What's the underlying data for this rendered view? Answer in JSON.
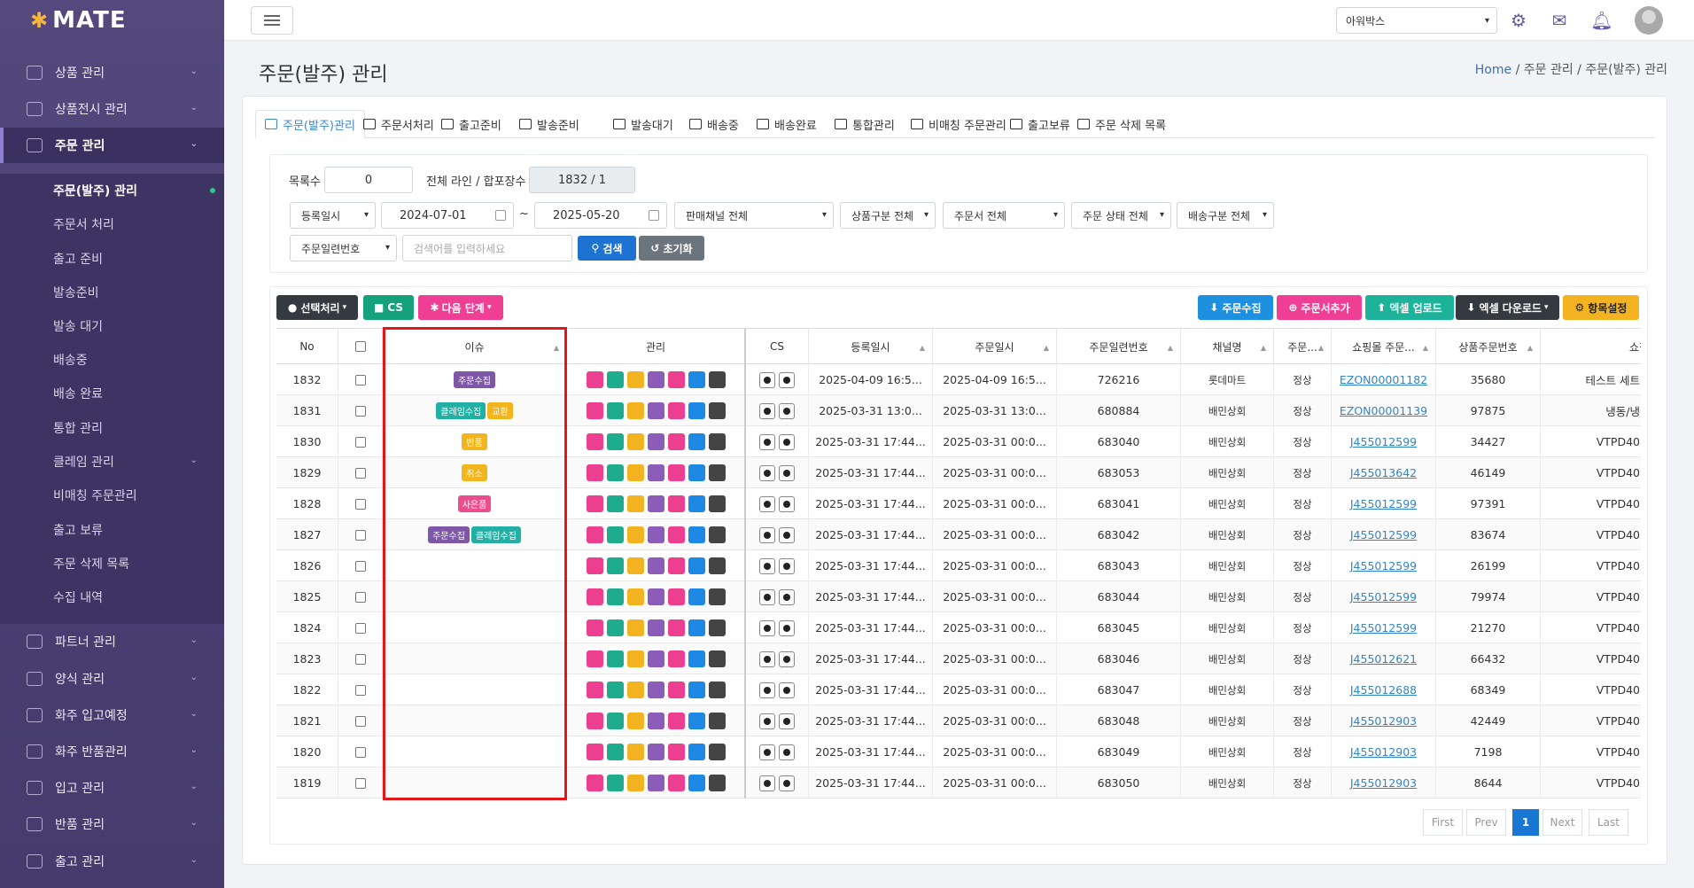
{
  "app": {
    "logo": "MATE"
  },
  "sidebar": {
    "top_items": [
      {
        "label": "상품 관리"
      },
      {
        "label": "상품전시 관리"
      },
      {
        "label": "주문 관리"
      }
    ],
    "sub_items": [
      {
        "label": "주문(발주) 관리"
      },
      {
        "label": "주문서 처리"
      },
      {
        "label": "출고 준비"
      },
      {
        "label": "발송준비"
      },
      {
        "label": "발송 대기"
      },
      {
        "label": "배송중"
      },
      {
        "label": "배송 완료"
      },
      {
        "label": "통합 관리"
      },
      {
        "label": "클레임 관리"
      },
      {
        "label": "비매칭 주문관리"
      },
      {
        "label": "출고 보류"
      },
      {
        "label": "주문 삭제 목록"
      },
      {
        "label": "수집 내역"
      }
    ],
    "bottom_items": [
      {
        "label": "파트너 관리"
      },
      {
        "label": "양식 관리"
      },
      {
        "label": "화주 입고예정"
      },
      {
        "label": "화주 반품관리"
      },
      {
        "label": "입고 관리"
      },
      {
        "label": "반품 관리"
      },
      {
        "label": "출고 관리"
      }
    ]
  },
  "topbar": {
    "company": "아워박스"
  },
  "page": {
    "title": "주문(발주) 관리",
    "breadcrumb": [
      "Home",
      "주문 관리",
      "주문(발주) 관리"
    ]
  },
  "tabs": [
    "주문(발주)관리",
    "주문서처리",
    "출고준비",
    "발송준비",
    "발송대기",
    "배송중",
    "배송완료",
    "통합관리",
    "비매칭 주문관리",
    "출고보류",
    "주문 삭제 목록"
  ],
  "filter": {
    "count_label": "목록수",
    "count_value": "0",
    "total_label": "전체 라인 / 합포장수",
    "total_value": "1832 / 1",
    "date_type": "등록일시",
    "date_from": "2024-07-01",
    "date_sep": "~",
    "date_to": "2025-05-20",
    "channel": "판매채널 전체",
    "product_type": "상품구분 전체",
    "order_doc": "주문서 전체",
    "order_status": "주문 상태 전체",
    "delivery_type": "배송구분 전체",
    "search_field": "주문일련번호",
    "search_placeholder": "검색어를 입력하세요",
    "search_btn": "검색",
    "reset_btn": "초기화"
  },
  "toolbar": {
    "select_action": "선택처리",
    "cs": "CS",
    "next_step": "다음 단계",
    "collect_order": "주문수집",
    "add_order": "주문서추가",
    "excel_upload": "엑셀 업로드",
    "excel_download": "엑셀 다운로드",
    "item_settings": "항목설정"
  },
  "table": {
    "headers": {
      "no": "No",
      "issue": "이슈",
      "manage": "관리",
      "cs": "CS",
      "reg_date": "등록일시",
      "order_date": "주문일시",
      "order_serial": "주문일련번호",
      "channel": "채널명",
      "order_status": "주문...",
      "mall_order": "쇼핑몰 주문...",
      "product_order": "상품주문번호",
      "mall_product": "쇼핑몰 상품"
    },
    "rows": [
      {
        "no": "1832",
        "issues": [
          {
            "t": "주문수집",
            "c": "#7e57a8"
          }
        ],
        "reg": "2025-04-09 16:5...",
        "ord": "2025-04-09 16:5...",
        "serial": "726216",
        "channel": "롯데마트",
        "status": "정상",
        "mall_order": "EZON00001182",
        "prod_order": "35680",
        "mall_prod": "테스트 세트"
      },
      {
        "no": "1831",
        "issues": [
          {
            "t": "클레임수집",
            "c": "#21b0a3"
          },
          {
            "t": "교환",
            "c": "#f2b51d"
          }
        ],
        "reg": "2025-03-31 13:0...",
        "ord": "2025-03-31 13:0...",
        "serial": "680884",
        "channel": "배민상회",
        "status": "정상",
        "mall_order": "EZON00001139",
        "prod_order": "97875",
        "mall_prod": "냉동/냉"
      },
      {
        "no": "1830",
        "issues": [
          {
            "t": "반품",
            "c": "#f2b51d"
          }
        ],
        "reg": "2025-03-31 17:44...",
        "ord": "2025-03-31 00:0...",
        "serial": "683040",
        "channel": "배민상회",
        "status": "정상",
        "mall_order": "J455012599",
        "prod_order": "34427",
        "mall_prod": "VTPD40"
      },
      {
        "no": "1829",
        "issues": [
          {
            "t": "취소",
            "c": "#f2b51d"
          }
        ],
        "reg": "2025-03-31 17:44...",
        "ord": "2025-03-31 00:0...",
        "serial": "683053",
        "channel": "배민상회",
        "status": "정상",
        "mall_order": "J455013642",
        "prod_order": "46149",
        "mall_prod": "VTPD40"
      },
      {
        "no": "1828",
        "issues": [
          {
            "t": "사은품",
            "c": "#ec4d8d"
          }
        ],
        "reg": "2025-03-31 17:44...",
        "ord": "2025-03-31 00:0...",
        "serial": "683041",
        "channel": "배민상회",
        "status": "정상",
        "mall_order": "J455012599",
        "prod_order": "97391",
        "mall_prod": "VTPD40"
      },
      {
        "no": "1827",
        "issues": [
          {
            "t": "주문수집",
            "c": "#7e57a8"
          },
          {
            "t": "클레임수집",
            "c": "#21b0a3"
          }
        ],
        "reg": "2025-03-31 17:44...",
        "ord": "2025-03-31 00:0...",
        "serial": "683042",
        "channel": "배민상회",
        "status": "정상",
        "mall_order": "J455012599",
        "prod_order": "83674",
        "mall_prod": "VTPD40"
      },
      {
        "no": "1826",
        "issues": [],
        "reg": "2025-03-31 17:44...",
        "ord": "2025-03-31 00:0...",
        "serial": "683043",
        "channel": "배민상회",
        "status": "정상",
        "mall_order": "J455012599",
        "prod_order": "26199",
        "mall_prod": "VTPD40"
      },
      {
        "no": "1825",
        "issues": [],
        "reg": "2025-03-31 17:44...",
        "ord": "2025-03-31 00:0...",
        "serial": "683044",
        "channel": "배민상회",
        "status": "정상",
        "mall_order": "J455012599",
        "prod_order": "79974",
        "mall_prod": "VTPD40"
      },
      {
        "no": "1824",
        "issues": [],
        "reg": "2025-03-31 17:44...",
        "ord": "2025-03-31 00:0...",
        "serial": "683045",
        "channel": "배민상회",
        "status": "정상",
        "mall_order": "J455012599",
        "prod_order": "21270",
        "mall_prod": "VTPD40"
      },
      {
        "no": "1823",
        "issues": [],
        "reg": "2025-03-31 17:44...",
        "ord": "2025-03-31 00:0...",
        "serial": "683046",
        "channel": "배민상회",
        "status": "정상",
        "mall_order": "J455012621",
        "prod_order": "66432",
        "mall_prod": "VTPD40"
      },
      {
        "no": "1822",
        "issues": [],
        "reg": "2025-03-31 17:44...",
        "ord": "2025-03-31 00:0...",
        "serial": "683047",
        "channel": "배민상회",
        "status": "정상",
        "mall_order": "J455012688",
        "prod_order": "68349",
        "mall_prod": "VTPD40"
      },
      {
        "no": "1821",
        "issues": [],
        "reg": "2025-03-31 17:44...",
        "ord": "2025-03-31 00:0...",
        "serial": "683048",
        "channel": "배민상회",
        "status": "정상",
        "mall_order": "J455012903",
        "prod_order": "42449",
        "mall_prod": "VTPD40"
      },
      {
        "no": "1820",
        "issues": [],
        "reg": "2025-03-31 17:44...",
        "ord": "2025-03-31 00:0...",
        "serial": "683049",
        "channel": "배민상회",
        "status": "정상",
        "mall_order": "J455012903",
        "prod_order": "7198",
        "mall_prod": "VTPD40"
      },
      {
        "no": "1819",
        "issues": [],
        "reg": "2025-03-31 17:44...",
        "ord": "2025-03-31 00:0...",
        "serial": "683050",
        "channel": "배민상회",
        "status": "정상",
        "mall_order": "J455012903",
        "prod_order": "8644",
        "mall_prod": "VTPD40"
      }
    ],
    "manage_button_colors": [
      "#ec3f8f",
      "#1fab8e",
      "#f3b320",
      "#8b5db8",
      "#ec3f8f",
      "#1e88e5",
      "#444444"
    ]
  },
  "pagination": [
    "First",
    "Prev",
    "1",
    "Next",
    "Last"
  ],
  "colors": {
    "accent": "#3a86d8",
    "highlight": "#e01818",
    "sidebar": "#4a3f72"
  }
}
